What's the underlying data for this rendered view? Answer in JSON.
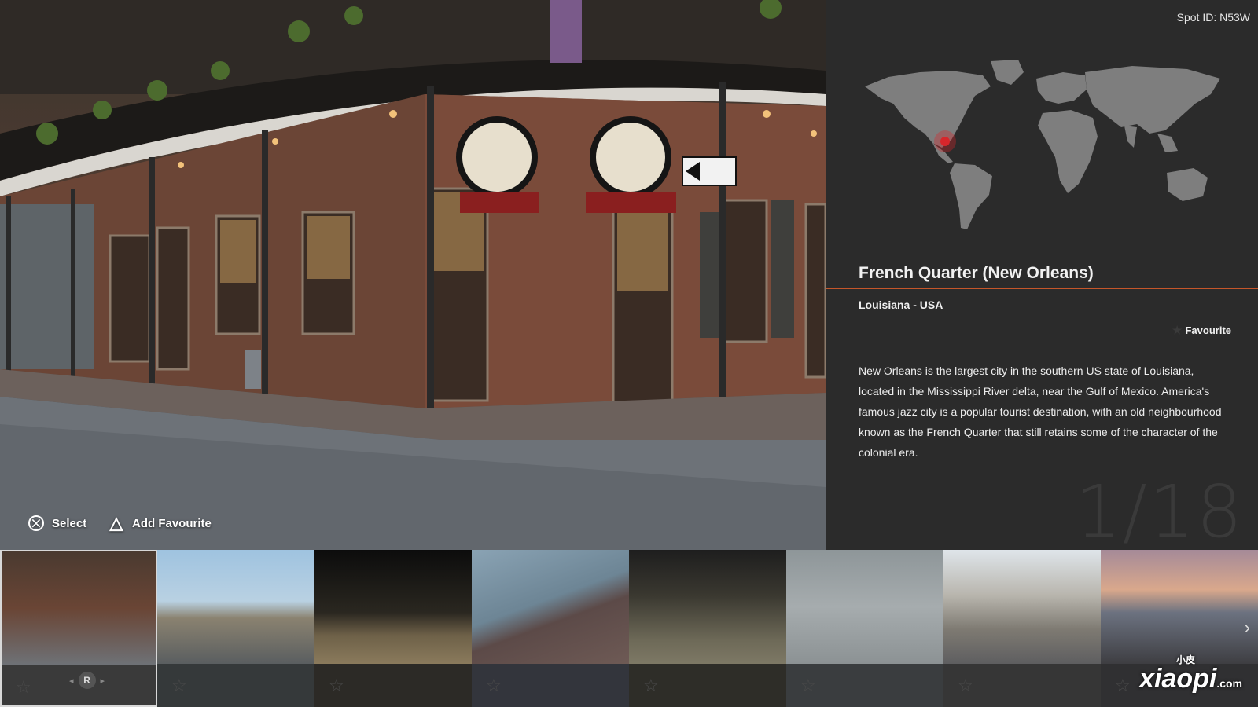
{
  "panel": {
    "spot_id": "Spot ID: N53W",
    "title": "French Quarter (New Orleans)",
    "region": "Louisiana - USA",
    "favourite_label": "Favourite",
    "description": "New Orleans is the largest city in the southern US state of Louisiana, located in the Mississippi River delta, near the Gulf of Mexico. America's famous jazz city is a popular tourist destination, with an old neighbourhood known as the French Quarter that still retains some of the character of the colonial era.",
    "counter": "1/18",
    "accent_color": "#c5562a",
    "map_marker_color": "#d7262b"
  },
  "hints": {
    "select_label": "Select",
    "add_favourite_label": "Add Favourite",
    "select_button": "⨉",
    "favourite_button": "△"
  },
  "strip": {
    "r_button": "R",
    "thumbnails": [
      {
        "name": "French Quarter",
        "selected": true
      },
      {
        "name": "industrial plant",
        "selected": false
      },
      {
        "name": "night plaza",
        "selected": false
      },
      {
        "name": "riverside pier",
        "selected": false
      },
      {
        "name": "arched warehouse",
        "selected": false
      },
      {
        "name": "concrete steps",
        "selected": false
      },
      {
        "name": "townhouses",
        "selected": false
      },
      {
        "name": "bridge at sunset",
        "selected": false
      }
    ]
  },
  "watermark": {
    "text": "xiaopi",
    "small": "小皮",
    "domain": ".com"
  }
}
